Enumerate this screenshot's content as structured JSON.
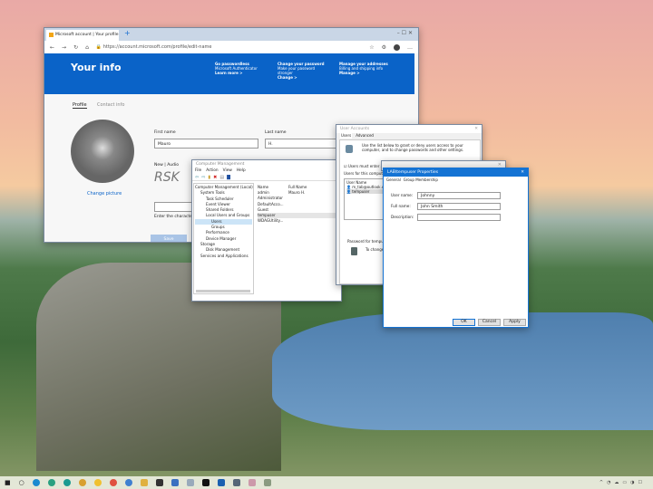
{
  "browser": {
    "tab_title": "Microsoft account | Your profile",
    "url": "https://account.microsoft.com/profile/edit-name",
    "banner": {
      "title": "Your info",
      "cards": [
        {
          "title": "Go passwordless",
          "desc": "Microsoft Authenticator",
          "link": "Learn more >"
        },
        {
          "title": "Change your password",
          "desc": "Make your password stronger",
          "link": "Change >"
        },
        {
          "title": "Manage your addresses",
          "desc": "Billing and shipping info",
          "link": "Manage >"
        }
      ]
    },
    "tabs": [
      "Profile",
      "Contact info"
    ],
    "change_picture": "Change picture",
    "first_name_label": "First name",
    "first_name": "Mauro",
    "last_name_label": "Last name",
    "last_name": "H.",
    "captcha_label": "New | Audio",
    "captcha_hint": "Enter the characters",
    "save": "Save"
  },
  "compmgmt": {
    "title": "Computer Management",
    "menu": [
      "File",
      "Action",
      "View",
      "Help"
    ],
    "tree": [
      "Computer Management (Local)",
      "System Tools",
      "Task Scheduler",
      "Event Viewer",
      "Shared Folders",
      "Local Users and Groups",
      "Users",
      "Groups",
      "Performance",
      "Device Manager",
      "Storage",
      "Disk Management",
      "Services and Applications"
    ],
    "columns": [
      "Name",
      "Full Name"
    ],
    "rows": [
      {
        "name": "admin",
        "full": "Mauro H."
      },
      {
        "name": "Administrator",
        "full": ""
      },
      {
        "name": "DefaultAcco...",
        "full": ""
      },
      {
        "name": "Guest",
        "full": ""
      },
      {
        "name": "tempuser",
        "full": ""
      },
      {
        "name": "WDAGUtility...",
        "full": ""
      }
    ]
  },
  "useraccounts": {
    "title": "User Accounts",
    "tabs": [
      "Users",
      "Advanced"
    ],
    "intro": "Use the list below to grant or deny users access to your computer, and to change passwords and other settings.",
    "checkbox": "Users must enter a user name and password to use this computer.",
    "list_label": "Users for this computer:",
    "col": "User Name",
    "users": [
      "m_tab@outlook.com",
      "tempuser"
    ],
    "password_label": "Password for tempuser",
    "password_hint": "To change the password"
  },
  "props": {
    "title": "LAB\\tempuser Properties",
    "tabs": [
      "General",
      "Group Membership"
    ],
    "user_name_label": "User name:",
    "user_name": "Johnny",
    "full_name_label": "Full name:",
    "full_name": "John Smith",
    "description_label": "Description:",
    "description": "",
    "ok": "OK",
    "cancel": "Cancel",
    "apply": "Apply"
  },
  "colors": {
    "accent": "#0a63c8",
    "titlebar_active": "#1473d4"
  }
}
